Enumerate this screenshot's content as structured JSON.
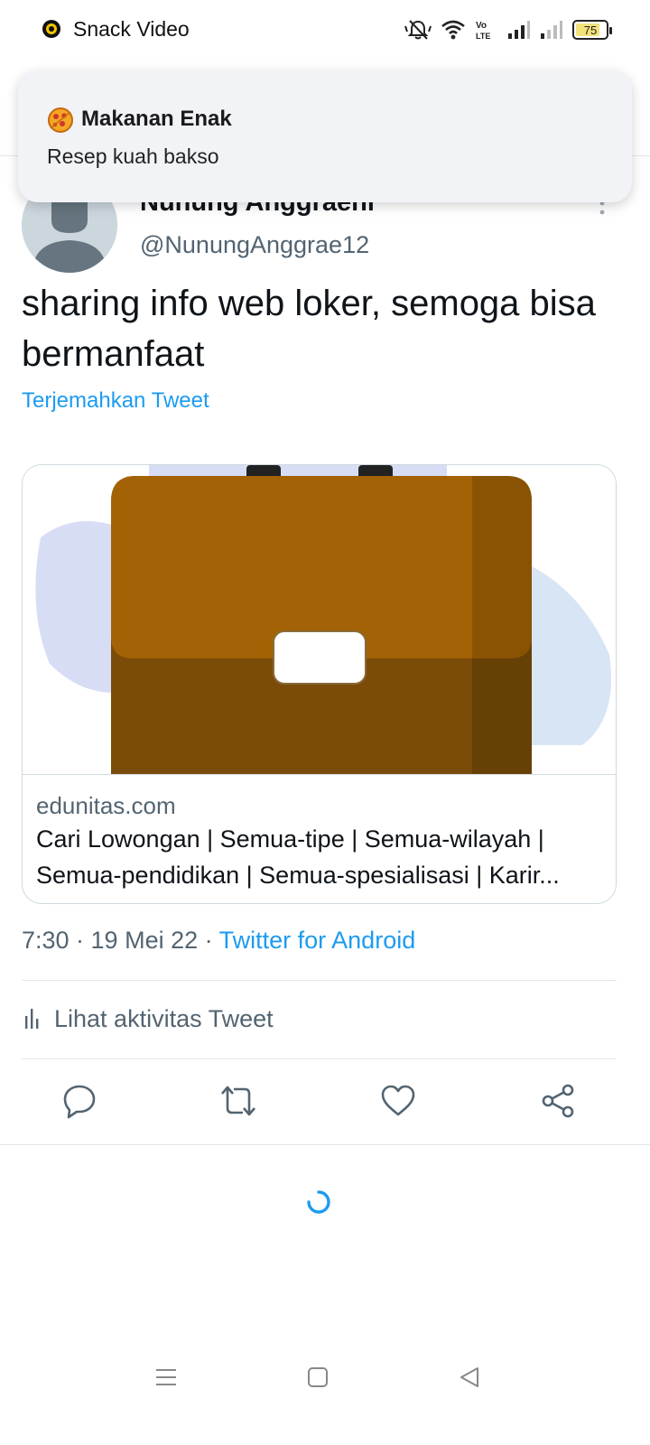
{
  "status_bar": {
    "app_name": "Snack Video",
    "battery_level": "75",
    "icons": [
      "snack-video-icon",
      "silent-icon",
      "wifi-icon",
      "volte-icon",
      "signal-icon",
      "signal-weak-icon",
      "battery-icon"
    ]
  },
  "notification": {
    "icon": "pizza-emoji-icon",
    "title": "Makanan Enak",
    "body": "Resep kuah bakso"
  },
  "tweet": {
    "author_name": "Nunung Anggraeni",
    "author_handle": "@NunungAnggrae12",
    "text": "sharing info web loker, semoga bisa bermanfaat",
    "translate_label": "Terjemahkan Tweet",
    "card": {
      "image": "briefcase-icon",
      "domain": "edunitas.com",
      "title": "Cari Lowongan | Semua-tipe | Semua-wilayah | Semua-pendidikan | Semua-spesialisasi | Karir..."
    },
    "timestamp": "7:30 · 19 Mei 22 · ",
    "source": "Twitter for Android",
    "activity_label": "Lihat aktivitas Tweet",
    "actions": [
      "reply-icon",
      "retweet-icon",
      "like-icon",
      "share-icon"
    ]
  },
  "nav_bar": [
    "menu-icon",
    "home-icon",
    "back-icon"
  ],
  "colors": {
    "link": "#1d9bf0",
    "secondary_text": "#536471",
    "briefcase_top": "#a36205",
    "briefcase_bottom": "#7a4c08"
  }
}
